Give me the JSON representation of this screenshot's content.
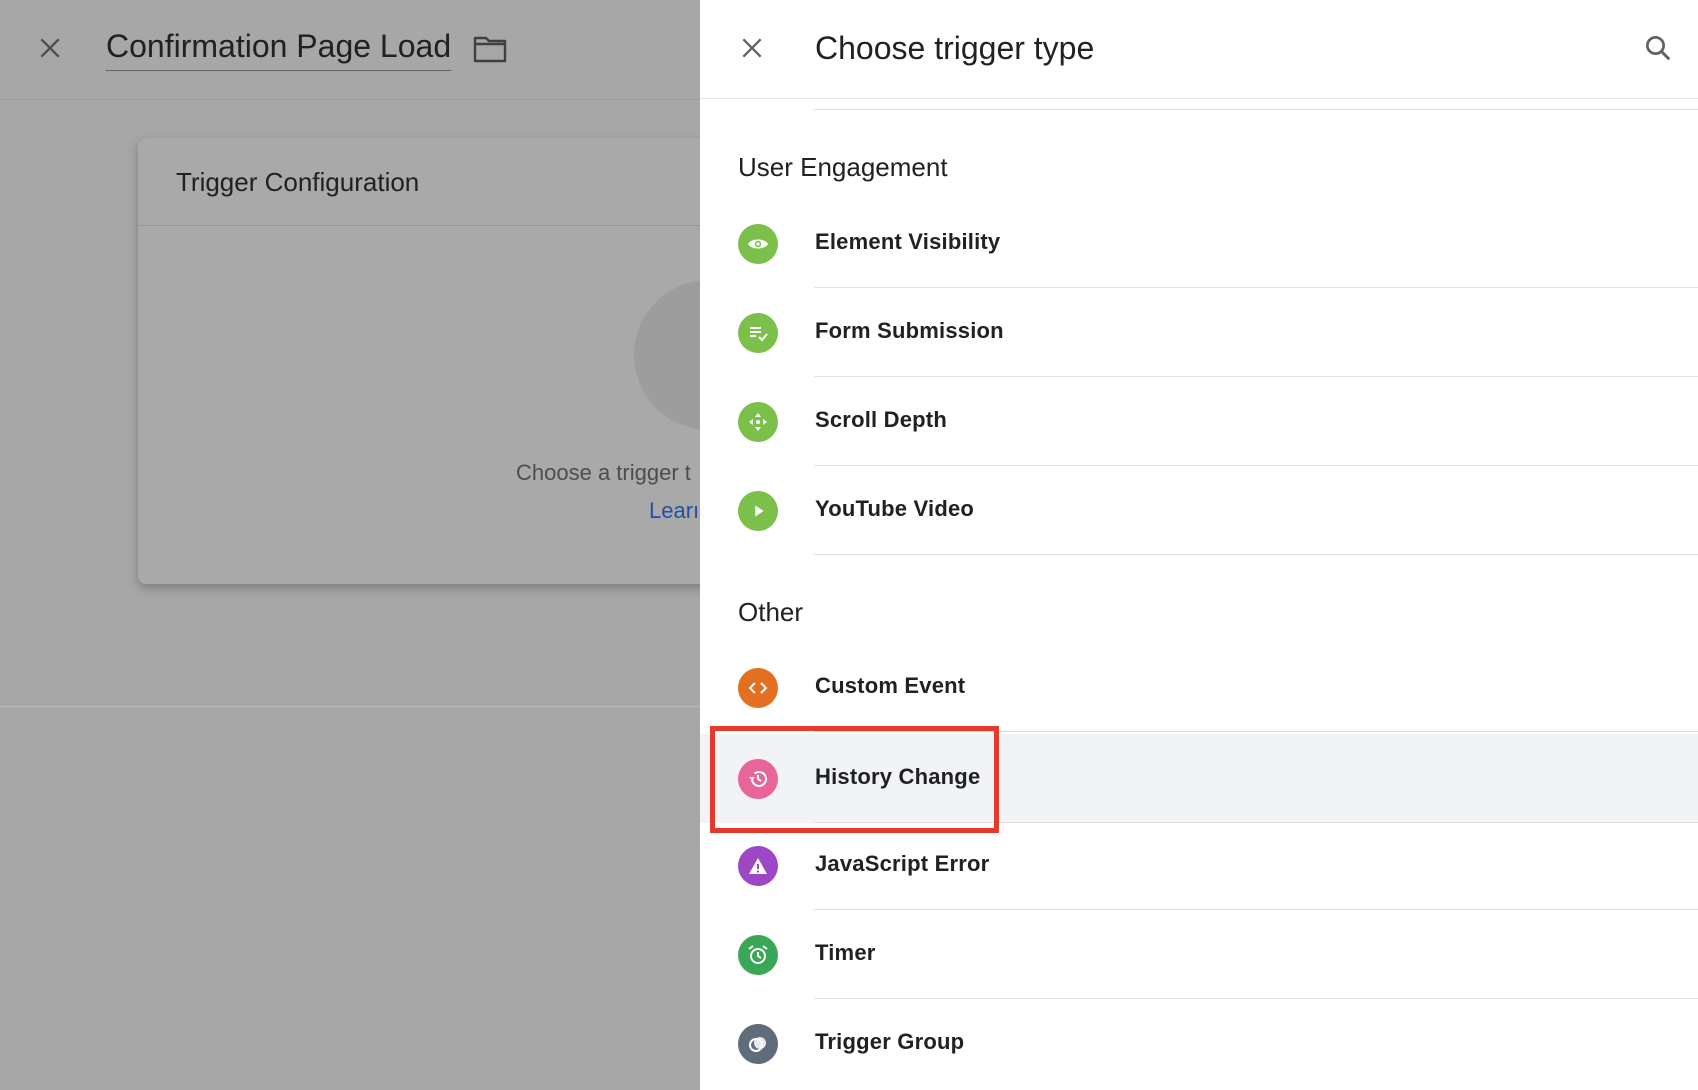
{
  "background": {
    "title": "Confirmation Page Load",
    "card_title": "Trigger Configuration",
    "card_text": "Choose a trigger t",
    "card_link": "Learı"
  },
  "drawer": {
    "title": "Choose trigger type",
    "sections": [
      {
        "title": "User Engagement",
        "items": [
          {
            "label": "Element Visibility",
            "icon": "eye-icon",
            "color": "#7cc04b"
          },
          {
            "label": "Form Submission",
            "icon": "form-check-icon",
            "color": "#7cc04b"
          },
          {
            "label": "Scroll Depth",
            "icon": "scroll-arrows-icon",
            "color": "#7cc04b"
          },
          {
            "label": "YouTube Video",
            "icon": "play-icon",
            "color": "#7cc04b"
          }
        ]
      },
      {
        "title": "Other",
        "items": [
          {
            "label": "Custom Event",
            "icon": "code-brackets-icon",
            "color": "#e36f20"
          },
          {
            "label": "History Change",
            "icon": "history-icon",
            "color": "#e8659a",
            "selected": true
          },
          {
            "label": "JavaScript Error",
            "icon": "warning-icon",
            "color": "#9d46c6"
          },
          {
            "label": "Timer",
            "icon": "alarm-icon",
            "color": "#3aa757"
          },
          {
            "label": "Trigger Group",
            "icon": "trigger-group-icon",
            "color": "#5f6c7b"
          }
        ]
      }
    ]
  },
  "annotation": {
    "highlight_color": "#e53a2b"
  }
}
